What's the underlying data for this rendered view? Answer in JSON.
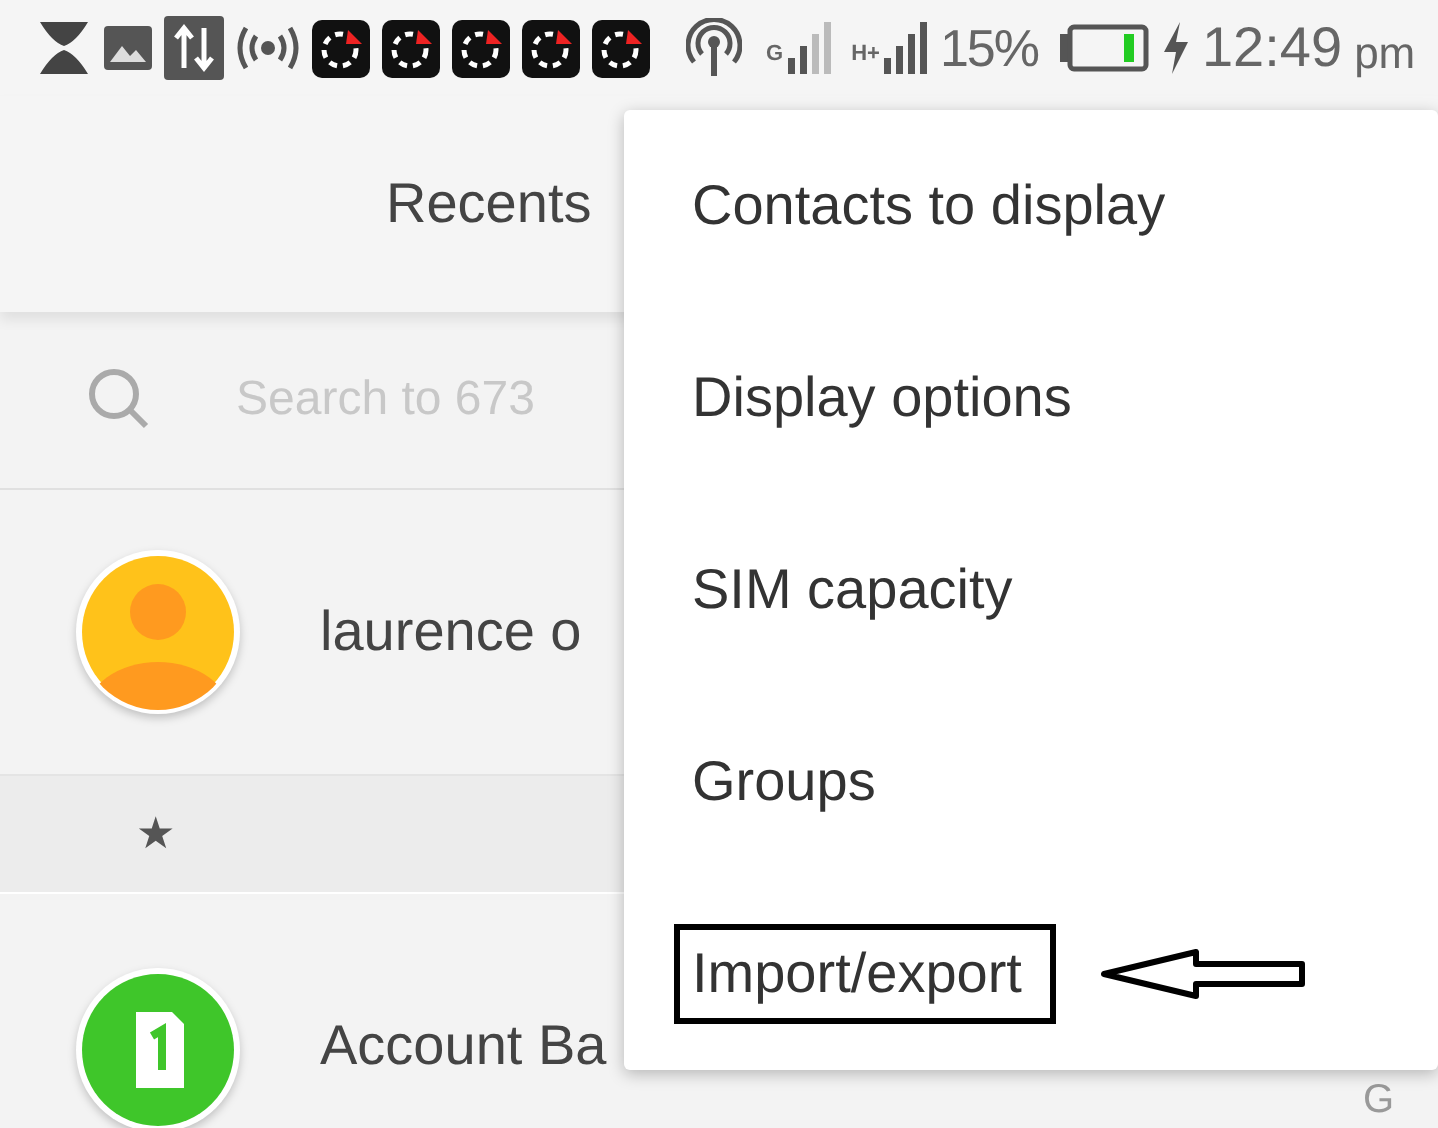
{
  "status_bar": {
    "network_label_1": "G",
    "network_label_2": "H+",
    "battery_percent": "15%",
    "time": "12:49",
    "time_suffix": "pm"
  },
  "header": {
    "tab_label": "Recents"
  },
  "search": {
    "placeholder": "Search to 673"
  },
  "contacts": [
    {
      "kind": "person",
      "name": "laurence o",
      "color": "#ffc21a"
    },
    {
      "kind": "section",
      "label": "★"
    },
    {
      "kind": "sim",
      "name": "Account Ba",
      "color": "#3fc62a"
    }
  ],
  "index_letter": "G",
  "menu": {
    "items": [
      {
        "label": "Contacts to display",
        "annotated": false
      },
      {
        "label": "Display options",
        "annotated": false
      },
      {
        "label": "SIM capacity",
        "annotated": false
      },
      {
        "label": "Groups",
        "annotated": false
      },
      {
        "label": "Import/export",
        "annotated": true
      }
    ]
  }
}
